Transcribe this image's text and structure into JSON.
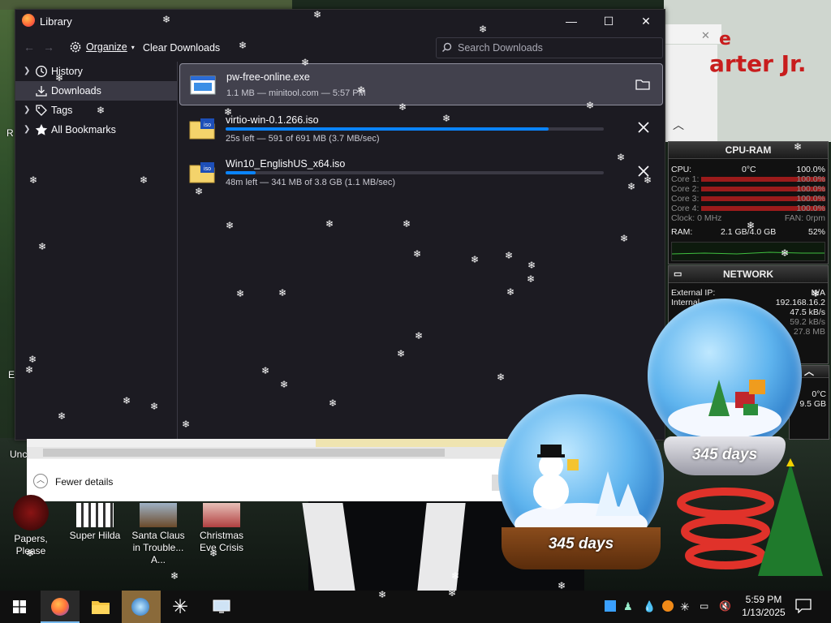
{
  "library": {
    "title": "Library",
    "window_controls": {
      "minimize": "—",
      "maximize": "☐",
      "close": "✕"
    },
    "toolbar": {
      "organize_label": "Organize",
      "clear_label": "Clear Downloads",
      "search_placeholder": "Search Downloads"
    },
    "sidebar": [
      {
        "label": "History",
        "icon": "clock-icon",
        "selected": false
      },
      {
        "label": "Downloads",
        "icon": "download-icon",
        "selected": true
      },
      {
        "label": "Tags",
        "icon": "tag-icon",
        "selected": false
      },
      {
        "label": "All Bookmarks",
        "icon": "star-icon",
        "selected": false
      }
    ],
    "downloads": [
      {
        "name": "pw-free-online.exe",
        "status": "1.1 MB — minitool.com — 5:57 PM",
        "progress": null,
        "action": "folder-icon",
        "selected": true
      },
      {
        "name": "virtio-win-0.1.266.iso",
        "status": "25s left — 591 of 691 MB (3.7 MB/sec)",
        "progress": 0.855,
        "action": "cancel-icon",
        "selected": false
      },
      {
        "name": "Win10_EnglishUS_x64.iso",
        "status": "48m left — 341 MB of 3.8 GB (1.1 MB/sec)",
        "progress": 0.08,
        "action": "cancel-icon",
        "selected": false
      }
    ],
    "accent_color": "#0a84ff"
  },
  "file_explorer": {
    "fewer_details_label": "Fewer details"
  },
  "background_app": {
    "text_line1": "e",
    "text_line2": "arter Jr."
  },
  "cpu_gadget": {
    "title": "CPU-RAM",
    "cpu_label": "CPU:",
    "cpu_temp": "0°C",
    "cpu_percent": "100.0%",
    "cores": [
      {
        "label": "Core 1:",
        "value": "100.0%"
      },
      {
        "label": "Core 2:",
        "value": "100.0%"
      },
      {
        "label": "Core 3:",
        "value": "100.0%"
      },
      {
        "label": "Core 4:",
        "value": "100.0%"
      }
    ],
    "clock_label": "Clock: 0 MHz",
    "fan_label": "FAN: 0rpm",
    "ram_label": "RAM:",
    "ram_value": "2.1 GB/4.0 GB",
    "ram_percent": "52%"
  },
  "network_gadget": {
    "title": "NETWORK",
    "external_ip_label": "External IP:",
    "external_ip_value": "N/A",
    "internal_label": "Internal",
    "internal_ip": "192.168.16.2",
    "rates": [
      "47.5 kB/s",
      "59.2 kB/s",
      "27.8 MB"
    ]
  },
  "sys_gadget": {
    "temp": "0°C",
    "storage": "9.5 GB"
  },
  "globes": [
    {
      "label": "345 days"
    },
    {
      "label": "345 days"
    }
  ],
  "desktop_icons": [
    {
      "label": "Papers, Please"
    },
    {
      "label": "Super Hilda"
    },
    {
      "label": "Santa Claus in Trouble... A..."
    },
    {
      "label": "Christmas Eve Crisis"
    }
  ],
  "desktop_partial_labels": {
    "left1": "Unc",
    "left2": "R",
    "left3": "E"
  },
  "taskbar": {
    "apps": [
      "windows-start-icon",
      "firefox-icon",
      "file-explorer-icon",
      "snowglobe-app-icon",
      "snowflake-app-icon",
      "monitor-app-icon"
    ],
    "clock_time": "5:59 PM",
    "clock_date": "1/13/2025"
  }
}
